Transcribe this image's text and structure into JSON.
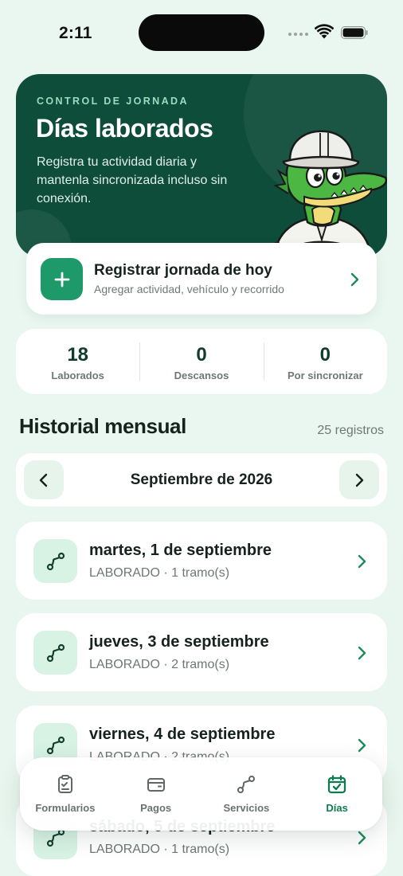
{
  "status_bar": {
    "time": "2:11"
  },
  "hero": {
    "eyebrow": "CONTROL DE JORNADA",
    "title": "Días laborados",
    "description": "Registra tu actividad diaria y mantenla sincronizada incluso sin conexión."
  },
  "register": {
    "title": "Registrar jornada de hoy",
    "subtitle": "Agregar actividad, vehículo y recorrido"
  },
  "stats": [
    {
      "value": "18",
      "label": "Laborados"
    },
    {
      "value": "0",
      "label": "Descansos"
    },
    {
      "value": "0",
      "label": "Por sincronizar"
    }
  ],
  "history": {
    "title": "Historial mensual",
    "count": "25 registros",
    "month": "Septiembre de 2026"
  },
  "days": [
    {
      "title": "martes, 1 de septiembre",
      "subtitle": "LABORADO · 1 tramo(s)"
    },
    {
      "title": "jueves, 3 de septiembre",
      "subtitle": "LABORADO · 2 tramo(s)"
    },
    {
      "title": "viernes, 4 de septiembre",
      "subtitle": "LABORADO · 2 tramo(s)"
    },
    {
      "title": "sábado, 5 de septiembre",
      "subtitle": "LABORADO · 1 tramo(s)"
    }
  ],
  "tabs": [
    {
      "label": "Formularios",
      "icon": "clipboard-icon"
    },
    {
      "label": "Pagos",
      "icon": "wallet-icon"
    },
    {
      "label": "Servicios",
      "icon": "route-icon"
    },
    {
      "label": "Días",
      "icon": "calendar-check-icon",
      "active": true
    }
  ],
  "colors": {
    "hero_bg": "#0f4d3b",
    "accent": "#1e9a6a",
    "active_tab": "#0e7a50",
    "icon_tint": "#d8f2e4"
  }
}
